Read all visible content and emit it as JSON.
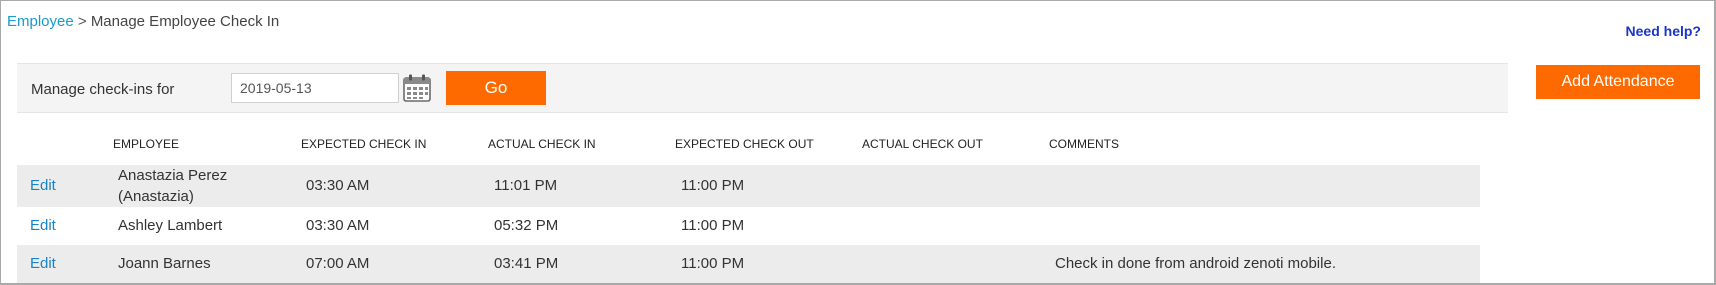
{
  "breadcrumb": {
    "root": "Employee",
    "separator": ">",
    "current": "Manage Employee Check In"
  },
  "help": {
    "label": "Need help?"
  },
  "filter": {
    "label": "Manage check-ins for",
    "date_value": "2019-05-13",
    "go_label": "Go"
  },
  "actions": {
    "add_attendance_label": "Add Attendance"
  },
  "table": {
    "headers": [
      "EMPLOYEE",
      "EXPECTED CHECK IN",
      "ACTUAL CHECK IN",
      "EXPECTED CHECK OUT",
      "ACTUAL CHECK OUT",
      "COMMENTS"
    ],
    "edit_label": "Edit",
    "rows": [
      {
        "employee": "Anastazia Perez (Anastazia)",
        "expected_in": "03:30 AM",
        "actual_in": "11:01 PM",
        "expected_out": "11:00 PM",
        "actual_out": "",
        "comments": ""
      },
      {
        "employee": "Ashley Lambert",
        "expected_in": "03:30 AM",
        "actual_in": "05:32 PM",
        "expected_out": "11:00 PM",
        "actual_out": "",
        "comments": ""
      },
      {
        "employee": "Joann Barnes",
        "expected_in": "07:00 AM",
        "actual_in": "03:41 PM",
        "expected_out": "11:00 PM",
        "actual_out": "",
        "comments": "Check in done from android zenoti mobile."
      }
    ]
  },
  "colors": {
    "accent": "#ff6a00",
    "link": "#1a9bc9",
    "help_link": "#1a35c9",
    "row_shade": "#ececec"
  },
  "icons": {
    "calendar": "calendar-icon"
  }
}
